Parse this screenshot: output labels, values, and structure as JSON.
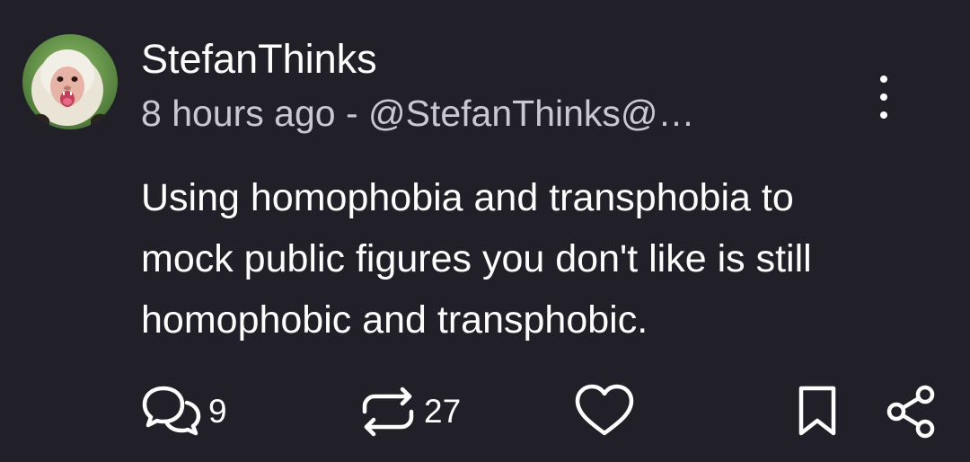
{
  "post": {
    "author": {
      "display_name": "StefanThinks",
      "avatar_icon": "capuchin-monkey-avatar"
    },
    "meta_text": "8 hours ago - @StefanThinks@…",
    "content_lines": [
      "Using homophobia and transphobia to",
      "mock public figures you don't like is still",
      "homophobic and transphobic."
    ],
    "actions": {
      "comment_count": "9",
      "boost_count": "27"
    }
  },
  "colors": {
    "background": "#212029",
    "text": "#ffffff",
    "meta_text": "#c9c7d1"
  },
  "icons": [
    "more-vertical-icon",
    "comment-icon",
    "boost-icon",
    "heart-icon",
    "bookmark-icon",
    "share-icon"
  ]
}
